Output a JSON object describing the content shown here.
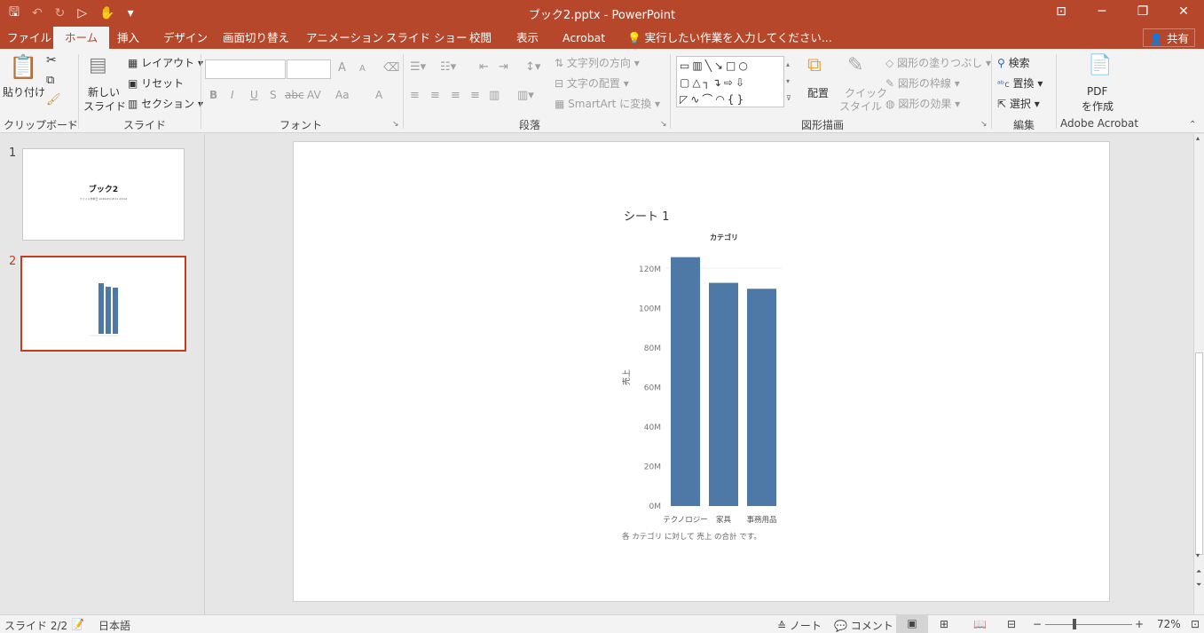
{
  "window": {
    "title": "ブック2.pptx - PowerPoint",
    "controls": [
      "⊡",
      "─",
      "❐",
      "✕"
    ]
  },
  "qat": {
    "save": "🖫",
    "undo": "↶",
    "redo": "↻",
    "from_start": "▷",
    "touch": "✋",
    "more": "▾"
  },
  "tabs": [
    {
      "label": "ファイル"
    },
    {
      "label": "ホーム"
    },
    {
      "label": "挿入"
    },
    {
      "label": "デザイン"
    },
    {
      "label": "画面切り替え"
    },
    {
      "label": "アニメーション"
    },
    {
      "label": "スライド ショー"
    },
    {
      "label": "校閲"
    },
    {
      "label": "表示"
    },
    {
      "label": "Acrobat"
    }
  ],
  "tell_me": "実行したい作業を入力してください...",
  "share": "共有",
  "ribbon": {
    "clipboard": {
      "paste": "貼り付け",
      "label": "クリップボード"
    },
    "slides": {
      "new_slide_1": "新しい",
      "new_slide_2": "スライド",
      "layout": "レイアウト",
      "reset": "リセット",
      "section": "セクション",
      "label": "スライド"
    },
    "font": {
      "label": "フォント",
      "grow": "A",
      "shrink": "A",
      "bold": "B",
      "italic": "I",
      "underline": "U",
      "shadow": "S",
      "strike": "abc",
      "spacing": "AV",
      "case": "Aa",
      "color": "A"
    },
    "paragraph": {
      "label": "段落",
      "text_direction": "文字列の方向",
      "align_text": "文字の配置",
      "smartart": "SmartArt に変換"
    },
    "drawing": {
      "arrange": "配置",
      "quick_styles_1": "クイック",
      "quick_styles_2": "スタイル",
      "fill": "図形の塗りつぶし",
      "outline": "図形の枠線",
      "effects": "図形の効果",
      "label": "図形描画"
    },
    "editing": {
      "find": "検索",
      "replace": "置換",
      "select": "選択",
      "label": "編集"
    },
    "acrobat": {
      "pdf_1": "PDF",
      "pdf_2": "を作成",
      "label": "Adobe Acrobat"
    }
  },
  "thumbnails": [
    {
      "number": "1",
      "title": "ブック2",
      "subtitle": "ファイル作成日 2026/05/18 11:43:02"
    },
    {
      "number": "2"
    }
  ],
  "slide": {
    "sheet_title": "シート 1",
    "caption": "各 カテゴリ に対して 売上 の合計 です。"
  },
  "chart_data": {
    "type": "bar",
    "title": "カテゴリ",
    "xlabel": "",
    "ylabel": "売上",
    "categories": [
      "テクノロジー",
      "家具",
      "事務用品"
    ],
    "values": [
      126,
      113,
      110
    ],
    "yticks": [
      "0M",
      "20M",
      "40M",
      "60M",
      "80M",
      "100M",
      "120M"
    ],
    "ylim": [
      0,
      120
    ],
    "grid": false,
    "bar_color": "#4e79a7"
  },
  "status": {
    "slide_info": "スライド 2/2",
    "language": "日本語",
    "notes": "ノート",
    "comments": "コメント",
    "zoom": "72%"
  },
  "colors": {
    "accent": "#b7472a",
    "selection": "#c43e1c"
  }
}
